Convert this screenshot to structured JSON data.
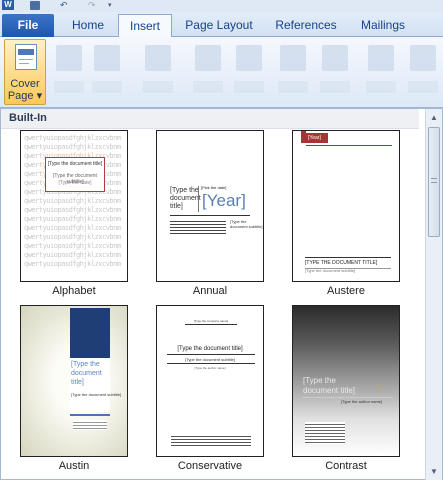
{
  "quick_access": {
    "app_logo": "W",
    "icons": [
      "word-logo-icon",
      "save-icon",
      "undo-icon",
      "redo-icon",
      "customize-qat-icon"
    ]
  },
  "tabs": {
    "file": "File",
    "home": "Home",
    "insert": "Insert",
    "page_layout": "Page Layout",
    "references": "References",
    "mailings": "Mailings"
  },
  "ribbon": {
    "cover_page_label": "Cover Page",
    "cover_page_dropdown": "▾"
  },
  "gallery": {
    "section_label": "Built-In",
    "items": [
      {
        "name": "Alphabet",
        "preview": {
          "pattern": "qwertyuiopasdfghjklzxcvbnmqwertyuiopasdfghjklzxcvbnmqwertyuiopasdfghjklzxcvbnmqwertyuiopasdfghjklzxcvbnmqwertyuiopasdfghjklzxcvbnmqwertyuiopasdfghjklzxcvbnmqwertyuiopasdfghjklzxcvbnmqwertyuiopasdfghjklzxcvbnmqwertyuiopasdfghjklzxcvbnmqwertyuiopasdfghjklzxcvbnmqwertyuiopasdfghjklzxcvbnmqwertyuiopasdfghjklzxcvbnmqwertyuiopasdfghjklzxcvbnmqwertyuiopasdfghjklzxcvbnmqwertyuiopasdfghjklzxcvbnm",
          "title": "[Type the document title]",
          "subtitle": "[Type the document subtitle]",
          "small": "[Type the date]"
        }
      },
      {
        "name": "Annual",
        "preview": {
          "date": "[Pick the date]",
          "title": "[Type the document title]",
          "year": "[Year]",
          "side": "[Type the document subtitle]"
        }
      },
      {
        "name": "Austere",
        "preview": {
          "year": "[Year]",
          "title": "[TYPE THE DOCUMENT TITLE]",
          "subtitle": "[Type the document subtitle]"
        }
      },
      {
        "name": "Austin",
        "preview": {
          "title": "[Type the document title]",
          "subtitle": "[Type the document subtitle]"
        }
      },
      {
        "name": "Conservative",
        "preview": {
          "top": "[Type the company name]",
          "title": "[Type the document title]",
          "subtitle": "[Type the document subtitle]",
          "author": "[Type the author name]"
        }
      },
      {
        "name": "Contrast",
        "preview": {
          "title": "[Type the document title]",
          "subtitle": "[Type the author name]"
        }
      }
    ]
  },
  "scrollbar": {
    "up_arrow": "▲",
    "down_arrow": "▼"
  },
  "colors": {
    "tab_active": "#f6f9fe",
    "file_tab": "#1d57ad",
    "cover_button": "#fdc859",
    "austere_accent": "#a83434",
    "austin_blue": "#1f3e75"
  }
}
